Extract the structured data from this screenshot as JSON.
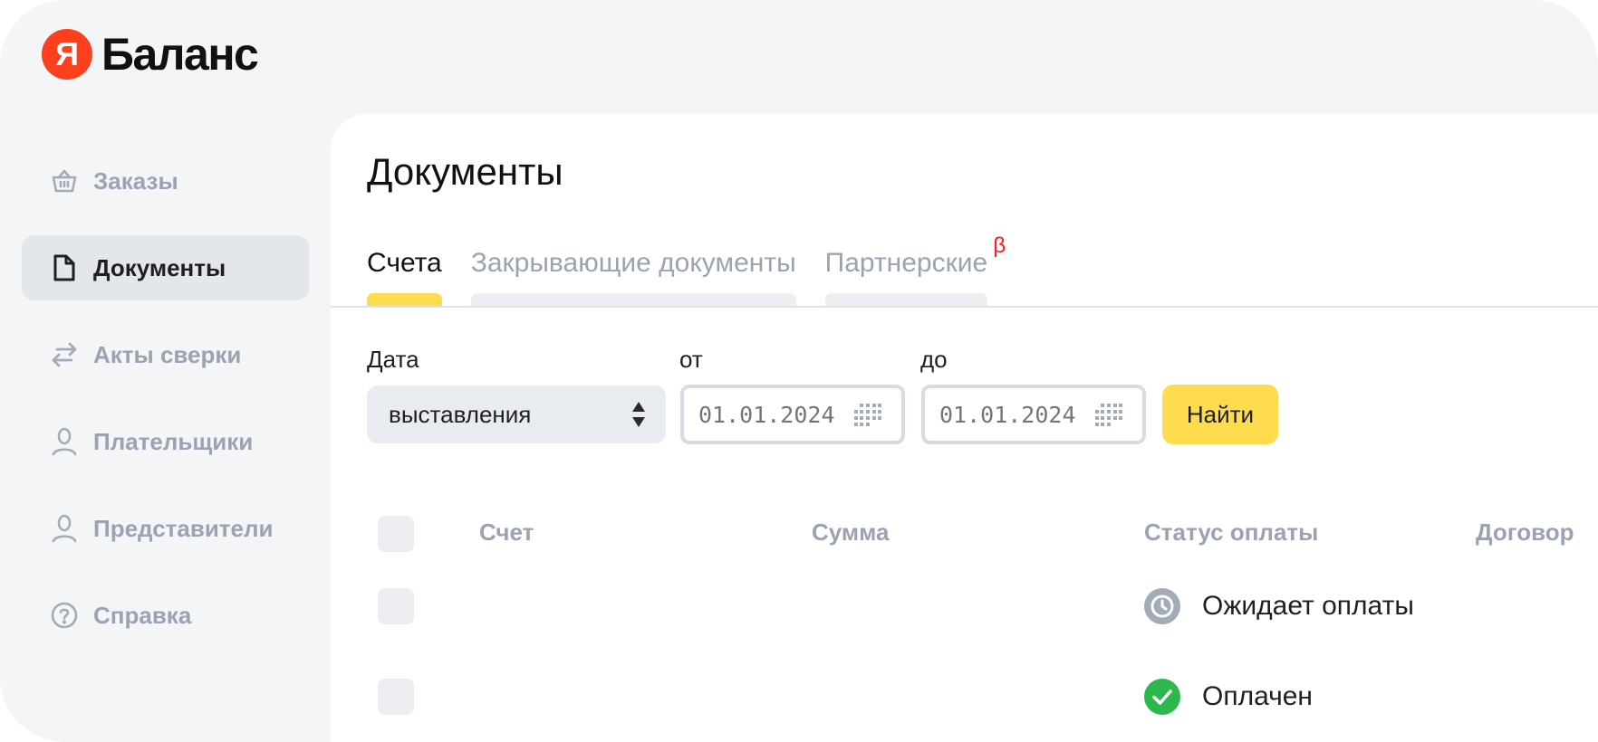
{
  "logo": {
    "mark": "Я",
    "text": "Баланс"
  },
  "sidebar": {
    "items": [
      {
        "label": "Заказы",
        "icon": "basket-icon",
        "active": false
      },
      {
        "label": "Документы",
        "icon": "document-icon",
        "active": true
      },
      {
        "label": "Акты сверки",
        "icon": "arrows-exchange-icon",
        "active": false
      },
      {
        "label": "Плательщики",
        "icon": "user-icon",
        "active": false
      },
      {
        "label": "Представители",
        "icon": "user-icon",
        "active": false
      },
      {
        "label": "Справка",
        "icon": "help-icon",
        "active": false
      }
    ]
  },
  "main": {
    "title": "Документы",
    "tabs": [
      {
        "label": "Счета",
        "active": true
      },
      {
        "label": "Закрывающие документы",
        "active": false
      },
      {
        "label": "Партнерские",
        "badge": "β",
        "active": false
      }
    ],
    "filters": {
      "date_label": "Дата",
      "date_type_value": "выставления",
      "from_label": "от",
      "from_value": "01.01.2024",
      "to_label": "до",
      "to_value": "01.01.2024",
      "find_label": "Найти"
    },
    "table": {
      "columns": [
        "Счет",
        "Сумма",
        "Статус оплаты",
        "Договор"
      ],
      "rows": [
        {
          "status": "Ожидает оплаты",
          "status_icon": "clock-icon"
        },
        {
          "status": "Оплачен",
          "status_icon": "check-circle-icon"
        }
      ]
    }
  },
  "colors": {
    "accent_yellow": "#ffdb4d",
    "brand_red": "#fc3f1d",
    "paid_green": "#2db84d",
    "pending_gray": "#a3abb8",
    "beta_red": "#ff1a1a"
  }
}
